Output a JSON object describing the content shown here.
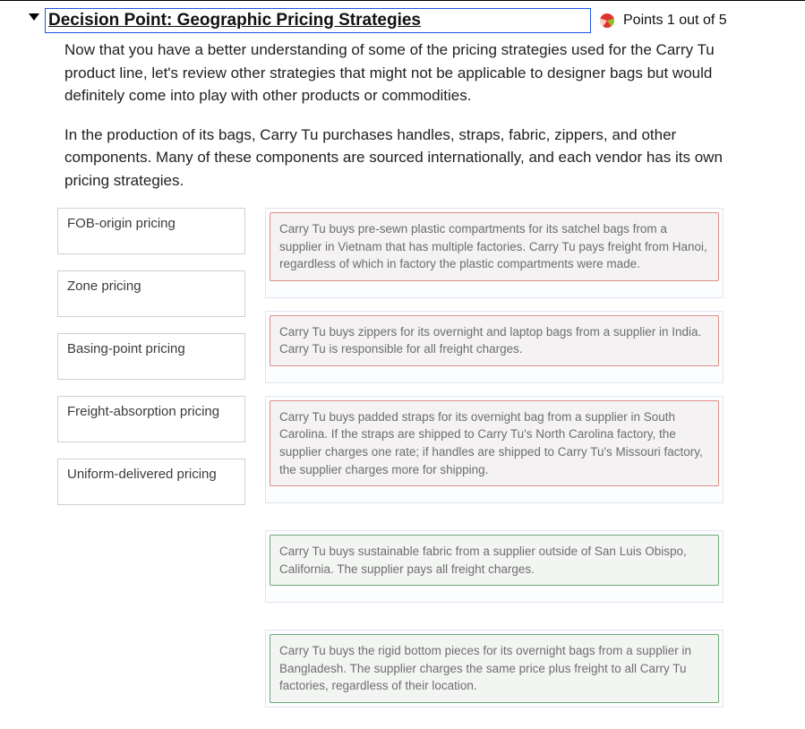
{
  "header": {
    "title": "Decision Point: Geographic Pricing Strategies",
    "points_label": "Points 1 out of 5"
  },
  "intro": {
    "p1": "Now that you have a better understanding of some of the pricing strategies used for the Carry Tu product line, let's review other strategies that might not be applicable to designer bags but would definitely come into play with other products or commodities.",
    "p2": "In the production of its bags, Carry Tu purchases handles, straps, fabric, zippers, and other components. Many of these components are sourced internationally, and each vendor has its own pricing strategies."
  },
  "terms": {
    "t1": "FOB-origin pricing",
    "t2": "Zone pricing",
    "t3": "Basing-point pricing",
    "t4": "Freight-absorption pricing",
    "t5": "Uniform-delivered pricing"
  },
  "scenarios": {
    "s1": "Carry Tu buys pre-sewn plastic compartments for its satchel bags from a supplier in Vietnam that has multiple factories. Carry Tu pays freight from Hanoi, regardless of which in factory the plastic compartments were made.",
    "s2": "Carry Tu buys zippers for its overnight and laptop bags from a supplier in India. Carry Tu is responsible for all freight charges.",
    "s3": "Carry Tu buys padded straps for its overnight bag from a supplier in South Carolina. If the straps are shipped to Carry Tu's North Carolina factory, the supplier charges one rate; if handles are shipped to Carry Tu's Missouri factory, the supplier charges more for shipping.",
    "s4": "Carry Tu buys sustainable fabric from a supplier outside of San Luis Obispo, California. The supplier pays all freight charges.",
    "s5": "Carry Tu buys the rigid bottom pieces for its overnight bags from a supplier in Bangladesh. The supplier charges the same price plus freight to all Carry Tu factories, regardless of their location."
  }
}
